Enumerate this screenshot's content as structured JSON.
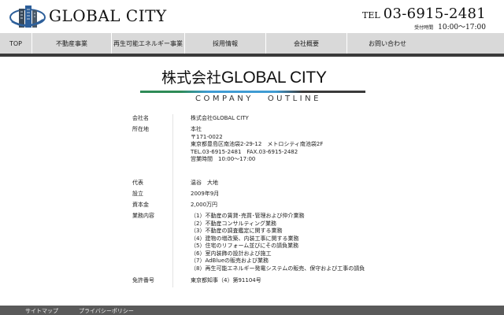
{
  "header": {
    "brand": "GLOBAL CITY",
    "tel_prefix": "TEL",
    "tel_number": "03-6915-2481",
    "hours_label": "受付時間",
    "hours_value": "10:00〜17:00"
  },
  "nav": {
    "items": [
      "TOP",
      "不動産事業",
      "再生可能エネルギー事業",
      "採用情報",
      "会社概要",
      "お問い合わせ"
    ]
  },
  "page": {
    "title_prefix": "株式会社",
    "title_main": "GLOBAL CITY",
    "subtitle_1": "COMPANY",
    "subtitle_2": "OUTLINE"
  },
  "company": {
    "name_label": "会社名",
    "name_value": "株式会社GLOBAL CITY",
    "address_label": "所在地",
    "address_lines": [
      "本社",
      "〒171-0022",
      "東京都豊島区南池袋2-29-12　メトロシティ南池袋2F",
      "TEL.03-6915-2481　FAX.03-6915-2482",
      "営業時間　10:00～17:00"
    ],
    "rep_label": "代表",
    "rep_value": "温谷　大地",
    "founded_label": "設立",
    "founded_value": "2009年9月",
    "capital_label": "資本金",
    "capital_value": "2,000万円",
    "business_label": "業務内容",
    "business_items": [
      "（1）不動産の賃貸･売買･管理および仲介業務",
      "（2）不動産コンサルティング業務",
      "（3）不動産の調査鑑定に関する業務",
      "（4）建物の増改築、内装工事に関する業務",
      "（5）住宅のリフォーム並びにその請負業務",
      "（6）室内装飾の設計および施工",
      "（7）AdBlueの販売および業務",
      "（8）再生可能エネルギー発電システムの販売、保守および工事の請負"
    ],
    "license_label": "免許番号",
    "license_value": "東京都知事（4）第91104号"
  },
  "footer": {
    "sitemap": "サイトマップ",
    "privacy": "プライバシーポリシー"
  },
  "colors": {
    "nav_bg": "#d9d9d9",
    "nav_border": "#3a3a3a",
    "logo_blue": "#2d5f9a",
    "rule_green": "#2e8b57",
    "rule_blue": "#3f9bd2",
    "footer_bg": "#5a5a5a"
  },
  "icons": {
    "logo": "building-globe-logo-icon"
  }
}
